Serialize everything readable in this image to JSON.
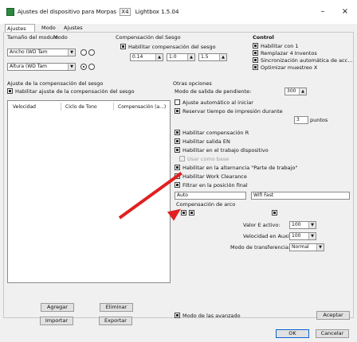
{
  "window": {
    "title": "Ajustes del dispositivo para Morpas",
    "title_version_tag": "X4",
    "title_suffix": "Lightbox 1.5.04",
    "minimize": "–",
    "close": "×"
  },
  "tabs": [
    "Ajustes Basicos",
    "Modo",
    "Ajustes Avanzados"
  ],
  "top_left": {
    "section_label": "Tamaño del modulo",
    "sub_label": "Modo",
    "row1_combo": "Ancho (WD Tam",
    "row2_combo": "Altura (WD Tam"
  },
  "top_middle": {
    "section_label": "Compensación del Sesgo",
    "checkbox_label": "Habilitar compensación del sesgo",
    "spin1": "0.14",
    "spin2": "1.0",
    "spin3": "1.5"
  },
  "control": {
    "title": "Control",
    "items": [
      "Habilitar con 1",
      "Remplazar 4 Inventos",
      "Sincronización automática de acc...",
      "Optimizar muestreo X"
    ]
  },
  "lower_left": {
    "header": "Ajuste de la compensación del sesgo",
    "checkbox_label": "Habilitar ajuste de la compensación del sesgo",
    "columns": [
      "Velocidad",
      "Ciclo de Tono",
      "Compensación (a...)"
    ],
    "add_button": "Agregar",
    "import_button": "Importar",
    "remove_button": "Eliminar",
    "export_button": "Exportar"
  },
  "right_panel": {
    "title": "Otras opciones",
    "speed_label": "Modo de salida de pendiente:",
    "speed_value": "300",
    "items": [
      "Ajuste automático al iniciar",
      "Reservar tiempo de impresión durante",
      "Habilitar compensación R",
      "Habilitar salida EN",
      "Habilitar en el trabajo dispositivo",
      "Usar como base",
      "Habilitar en la alternancia \"Parte de trabajo\"",
      "Habilitar Work Clearance",
      "Filtrar en la posición final",
      "Compensación de arco"
    ],
    "inline_value": "3",
    "inline_unit": "puntos",
    "field1": "Auto",
    "field2": "Wifi Fast",
    "ratio_label": "Valor E activo:",
    "ratio_value": "100",
    "speed2_label": "Velocidad en Auxiliar:",
    "speed2_value": "100",
    "mode_label": "Modo de transferencia:",
    "mode_value": "Normal"
  },
  "footer": {
    "checkbox_label": "Modo de las avanzado",
    "accept": "Aceptar",
    "ok": "OK",
    "cancel": "Cancelar"
  }
}
